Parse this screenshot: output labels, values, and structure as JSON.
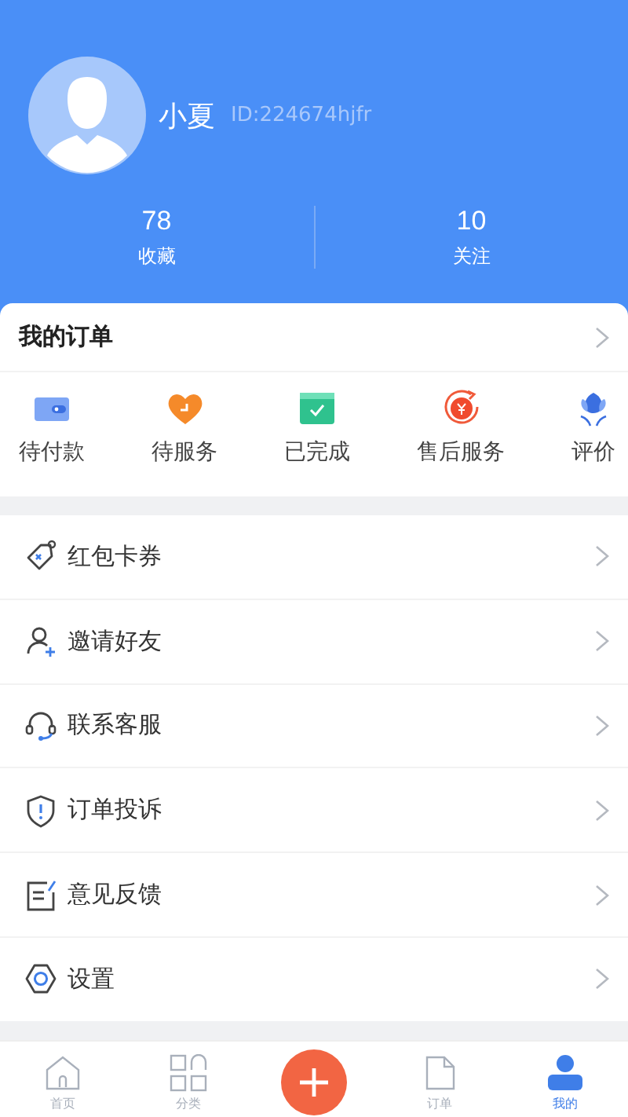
{
  "profile": {
    "name": "小夏",
    "id_text": "ID:224674hjfr"
  },
  "stats": [
    {
      "value": "78",
      "label": "收藏"
    },
    {
      "value": "10",
      "label": "关注"
    }
  ],
  "orders": {
    "title": "我的订单",
    "items": [
      {
        "kind": "wallet",
        "label": "待付款"
      },
      {
        "kind": "heart",
        "label": "待服务"
      },
      {
        "kind": "done",
        "label": "已完成"
      },
      {
        "kind": "refund",
        "label": "售后服务"
      },
      {
        "kind": "flower",
        "label": "评价"
      }
    ]
  },
  "menu": [
    {
      "kind": "coupon",
      "label": "红包卡券"
    },
    {
      "kind": "invite",
      "label": "邀请好友"
    },
    {
      "kind": "headset",
      "label": "联系客服"
    },
    {
      "kind": "shield",
      "label": "订单投诉"
    },
    {
      "kind": "feedback",
      "label": "意见反馈"
    },
    {
      "kind": "settings",
      "label": "设置"
    }
  ],
  "tabbar": [
    {
      "kind": "home",
      "label": "首页",
      "selected": false
    },
    {
      "kind": "grid",
      "label": "分类",
      "selected": false
    },
    {
      "kind": "plus",
      "selected": false
    },
    {
      "kind": "doc",
      "label": "订单",
      "selected": false
    },
    {
      "kind": "user",
      "label": "我的",
      "selected": true
    }
  ]
}
